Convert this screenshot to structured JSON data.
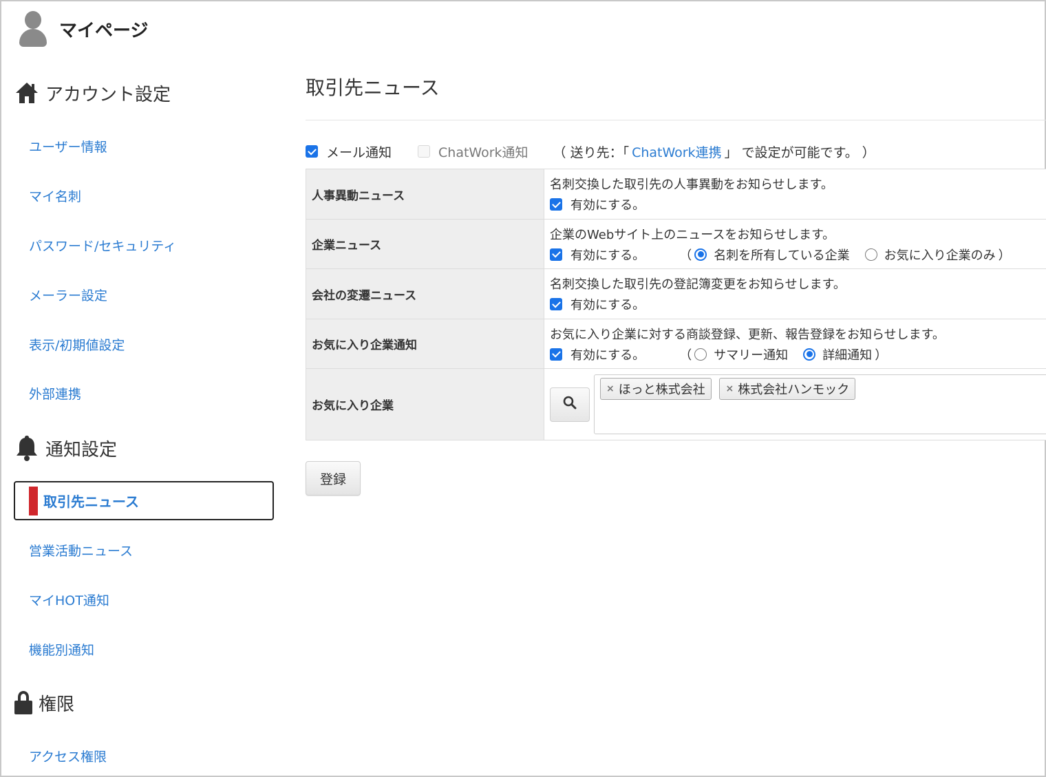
{
  "header": {
    "title": "マイページ"
  },
  "sidebar": {
    "sections": [
      {
        "title": "アカウント設定",
        "icon": "home-icon"
      },
      {
        "title": "通知設定",
        "icon": "bell-icon"
      },
      {
        "title": "権限",
        "icon": "lock-icon"
      }
    ],
    "account_links": [
      "ユーザー情報",
      "マイ名刺",
      "パスワード/セキュリティ",
      "メーラー設定",
      "表示/初期値設定",
      "外部連携"
    ],
    "notify_links": {
      "active": "取引先ニュース",
      "others": [
        "営業活動ニュース",
        "マイHOT通知",
        "機能別通知"
      ]
    },
    "permission_links": [
      "アクセス権限"
    ]
  },
  "main": {
    "title": "取引先ニュース",
    "notify": {
      "mail_label": "メール通知",
      "mail_checked": true,
      "chatwork_label": "ChatWork通知",
      "chatwork_checked": false,
      "note_prefix": "（ 送り先：「",
      "note_link": "ChatWork連携",
      "note_suffix": "」 で設定が可能です。 ）"
    },
    "rows": [
      {
        "label": "人事異動ニュース",
        "desc": "名刺交換した取引先の人事異動をお知らせします。",
        "enable": "有効にする。",
        "checked": true
      },
      {
        "label": "企業ニュース",
        "desc": "企業のWebサイト上のニュースをお知らせします。",
        "enable": "有効にする。",
        "checked": true,
        "open": "（",
        "opt1": "名刺を所有している企業",
        "opt2": "お気に入り企業のみ",
        "close": "）",
        "selected": 1
      },
      {
        "label": "会社の変遷ニュース",
        "desc": "名刺交換した取引先の登記簿変更をお知らせします。",
        "enable": "有効にする。",
        "checked": true
      },
      {
        "label": "お気に入り企業通知",
        "desc": "お気に入り企業に対する商談登録、更新、報告登録をお知らせします。",
        "enable": "有効にする。",
        "checked": true,
        "open": "（",
        "opt1": "サマリー通知",
        "opt2": "詳細通知",
        "close": "）",
        "selected": 2
      },
      {
        "label": "お気に入り企業",
        "tags": [
          "ほっと株式会社",
          "株式会社ハンモック"
        ]
      }
    ],
    "submit_label": "登録"
  },
  "colors": {
    "link": "#2a7bd1",
    "accent_bar": "#d0272c",
    "checkbox": "#1a73e8"
  }
}
